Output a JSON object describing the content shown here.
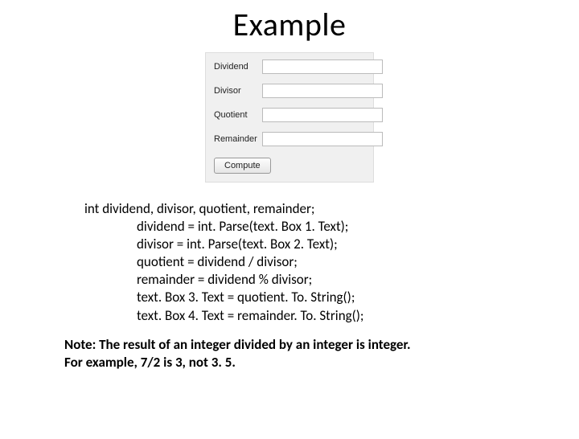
{
  "title": "Example",
  "form": {
    "labels": {
      "dividend": "Dividend",
      "divisor": "Divisor",
      "quotient": "Quotient",
      "remainder": "Remainder"
    },
    "values": {
      "dividend": "",
      "divisor": "",
      "quotient": "",
      "remainder": ""
    },
    "button": "Compute"
  },
  "code": {
    "l1": "int dividend, divisor, quotient, remainder;",
    "l2": "dividend = int. Parse(text. Box 1. Text);",
    "l3": "divisor = int. Parse(text. Box 2. Text);",
    "l4": "quotient = dividend / divisor;",
    "l5": "remainder = dividend % divisor;",
    "l6": "text. Box 3. Text = quotient. To. String();",
    "l7": "text. Box 4. Text = remainder. To. String();"
  },
  "note": {
    "line1": "Note: The result of an integer divided by an integer is integer.",
    "line2": "For example, 7/2 is 3, not 3. 5."
  }
}
